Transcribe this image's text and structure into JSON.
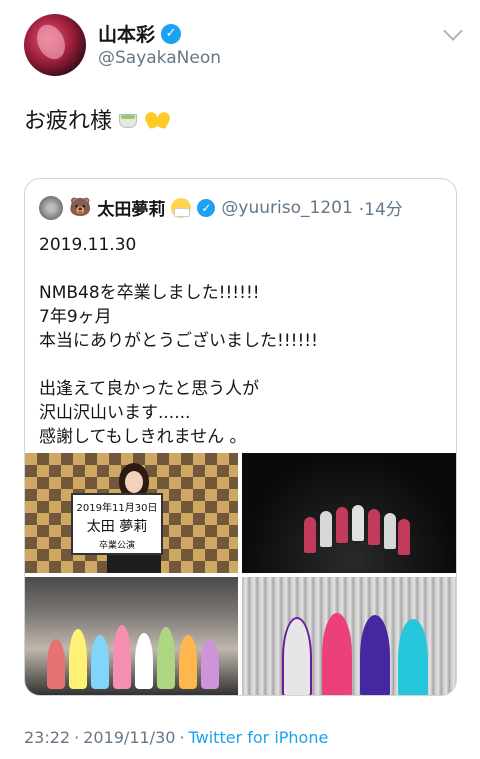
{
  "tweet": {
    "display_name": "山本彩",
    "handle": "@SayakaNeon",
    "text": "お疲れ様",
    "emojis": [
      "tea-emoji",
      "hands-emoji"
    ],
    "time": "23:22",
    "separator": "·",
    "date": "2019/11/30",
    "separator2": "·",
    "source": "Twitter for iPhone"
  },
  "quoted": {
    "bear": "🐻",
    "display_name": "太田夢莉",
    "handle": "@yuuriso_1201",
    "age": "·14分",
    "lines": [
      "2019.11.30",
      "",
      "NMB48を卒業しました!!!!!!",
      "7年9ヶ月",
      "本当にありがとうございました!!!!!!",
      "",
      "出逢えて良かったと思う人が",
      "沢山沢山います......",
      "感謝してもしきれません 。"
    ],
    "sign": {
      "date": "2019年11月30日",
      "name": "太田 夢莉",
      "event": "卒業公演"
    }
  },
  "colors": {
    "accent": "#1da1f2",
    "muted": "#657786",
    "border": "#ccd6dd"
  }
}
